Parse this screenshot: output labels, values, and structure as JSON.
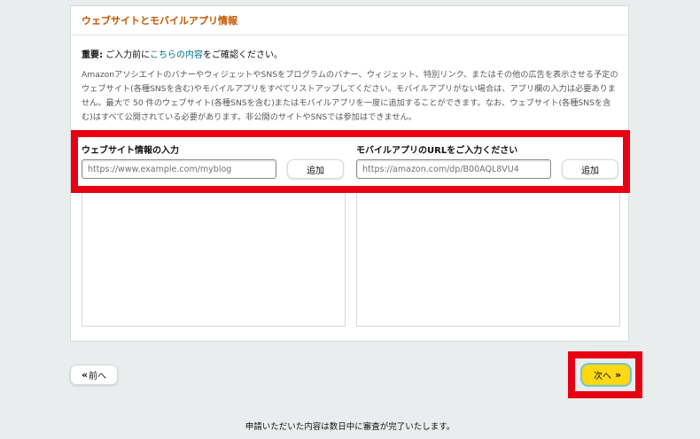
{
  "section": {
    "title": "ウェブサイトとモバイルアプリ情報",
    "notice_bold": "重要:",
    "notice_pre": " ご入力前に",
    "notice_link": "こちらの内容",
    "notice_post": "をご確認ください。",
    "description": "AmazonアソシエイトのバナーやウィジェットやSNSをプログラムのバナー、ウィジェット、特別リンク、またはその他の広告を表示させる予定のウェブサイト(各種SNSを含む)やモバイルアプリをすべてリストアップしてください。モバイルアプリがない場合は、アプリ欄の入力は必要ありません。最大で 50 件のウェブサイト(各種SNSを含む)またはモバイルアプリを一度に追加することができます。なお、ウェブサイト(各種SNSを含む)はすべて公開されている必要があります。非公開のサイトやSNSでは参加はできません。"
  },
  "website": {
    "label": "ウェブサイト情報の入力",
    "placeholder": "https://www.example.com/myblog",
    "add_label": "追加"
  },
  "mobile": {
    "label": "モバイルアプリのURLをご入力ください",
    "placeholder": "https://amazon.com/dp/B00AQL8VU4",
    "add_label": "追加"
  },
  "nav": {
    "prev_label": "前へ",
    "next_label": "次へ"
  },
  "footer_text": "申請いただいた内容は数日中に審査が完了いたします。",
  "colors": {
    "highlight": "#e60012",
    "primary_button": "#ffd814",
    "title": "#c45500",
    "link": "#007185"
  }
}
